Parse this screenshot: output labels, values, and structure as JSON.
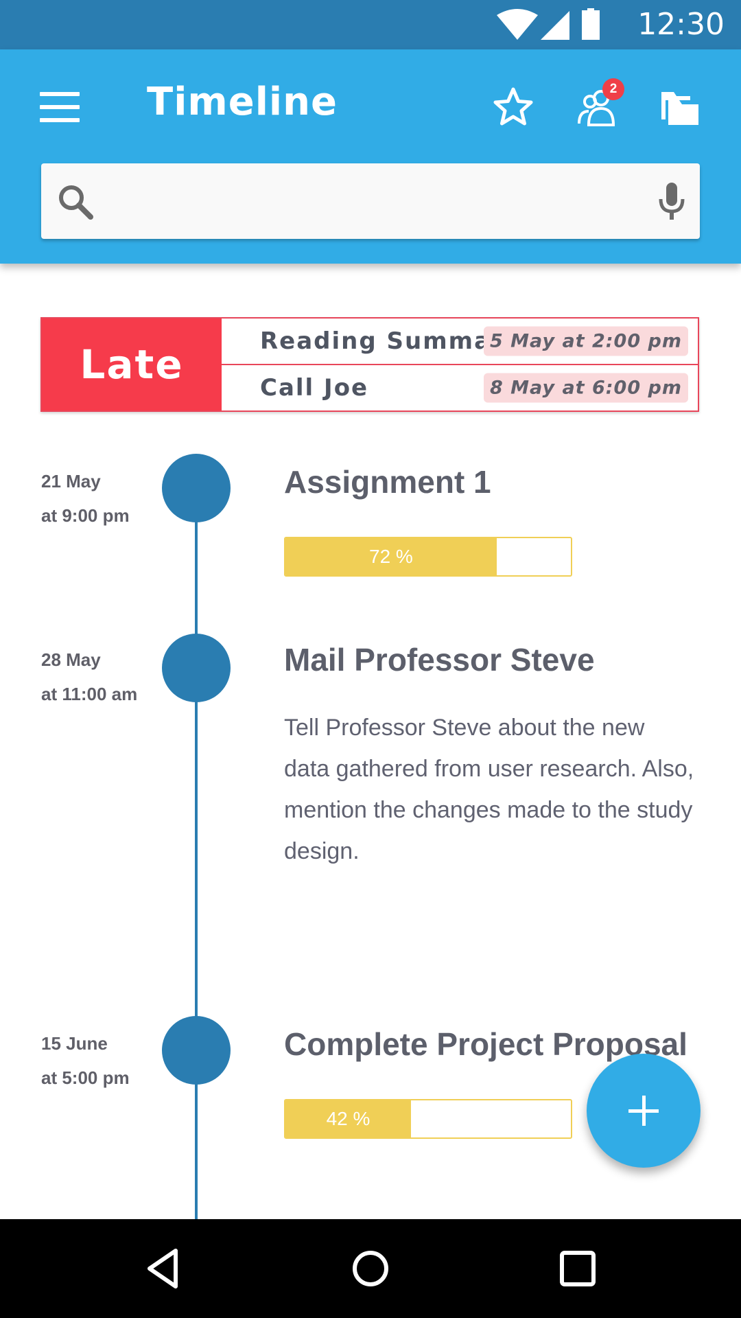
{
  "status_bar": {
    "time": "12:30"
  },
  "appbar": {
    "title": "Timeline",
    "notification_count": "2",
    "search_placeholder": ""
  },
  "late": {
    "label": "Late",
    "items": [
      {
        "title": "Reading Summaries",
        "when": "5 May at 2:00 pm"
      },
      {
        "title": "Call Joe",
        "when": "8 May at 6:00 pm"
      }
    ]
  },
  "events": [
    {
      "date_line1": "21 May",
      "date_line2": "at 9:00 pm",
      "title": "Assignment 1",
      "progress": 72,
      "progress_label": "72 %"
    },
    {
      "date_line1": "28 May",
      "date_line2": "at 11:00 am",
      "title": "Mail Professor Steve",
      "description": "Tell Professor Steve about the new data gathered from user research. Also, mention the changes made to the study design."
    },
    {
      "date_line1": "15 June",
      "date_line2": "at 5:00 pm",
      "title": "Complete Project Proposal",
      "progress": 42,
      "progress_label": "42 %"
    }
  ],
  "colors": {
    "primary": "#31ace6",
    "primary_dark": "#2a7db1",
    "late": "#f63b4b",
    "progress": "#f0cf56"
  },
  "icons": [
    "wifi-icon",
    "signal-icon",
    "battery-icon",
    "menu-icon",
    "star-icon",
    "people-icon",
    "folder-icon",
    "search-icon",
    "mic-icon",
    "add-icon",
    "back-icon",
    "home-icon",
    "recents-icon"
  ]
}
